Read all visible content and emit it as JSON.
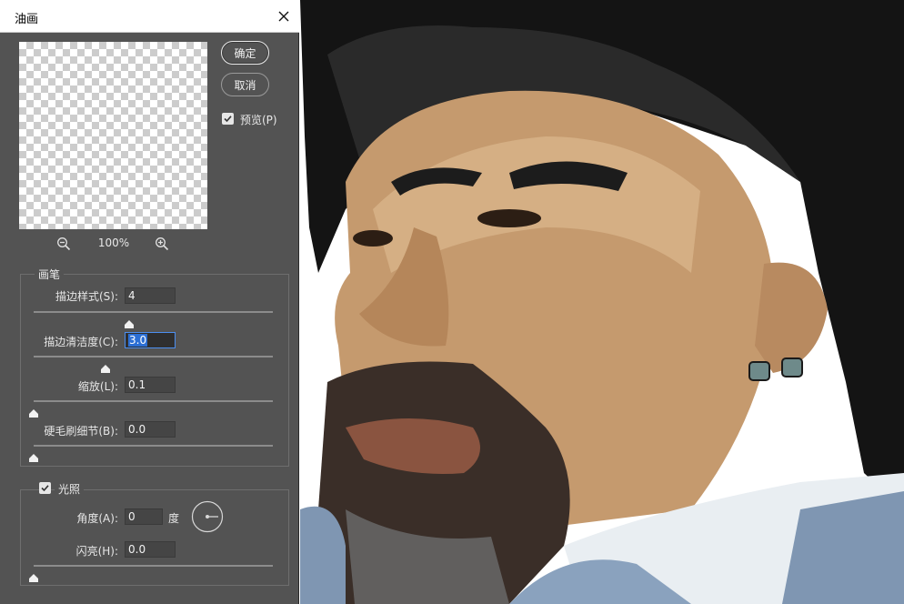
{
  "dialog": {
    "title": "油画",
    "buttons": {
      "ok": "确定",
      "cancel": "取消"
    },
    "preview_checkbox": {
      "label": "预览(P)",
      "checked": true
    },
    "zoom": {
      "level": "100%"
    }
  },
  "brush": {
    "title": "画笔",
    "stylization": {
      "label": "描边样式(S):",
      "value": "4",
      "slider_fraction": 0.4
    },
    "cleanliness": {
      "label": "描边清洁度(C):",
      "value": "3.0",
      "slider_fraction": 0.3
    },
    "scale": {
      "label": "缩放(L):",
      "value": "0.1",
      "slider_fraction": 0.0
    },
    "bristle_detail": {
      "label": "硬毛刷细节(B):",
      "value": "0.0",
      "slider_fraction": 0.0
    }
  },
  "lighting": {
    "title": "光照",
    "checked": true,
    "angle": {
      "label": "角度(A):",
      "value": "0",
      "unit": "度"
    },
    "shine": {
      "label": "闪亮(H):",
      "value": "0.0",
      "slider_fraction": 0.0
    }
  },
  "colors": {
    "dialog_bg": "#535353",
    "field_bg": "#454545",
    "accent": "#2c6fd4"
  }
}
